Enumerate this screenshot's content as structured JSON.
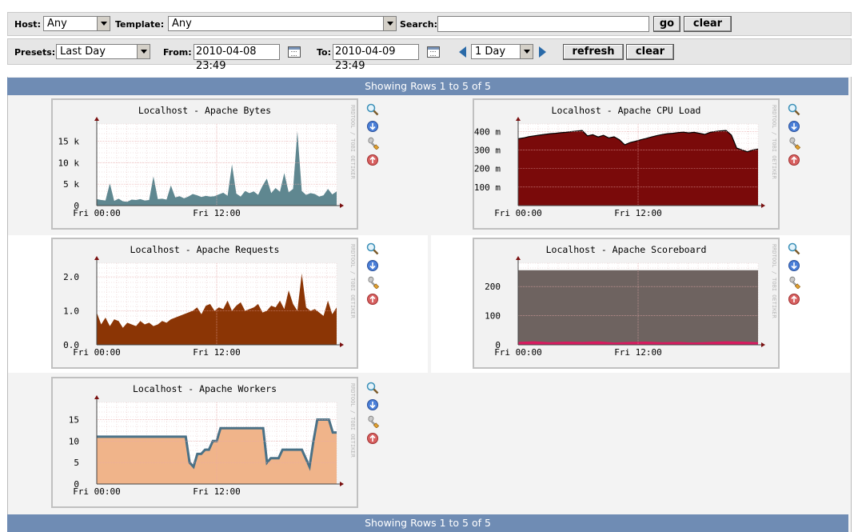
{
  "filter": {
    "host_label": "Host:",
    "host_value": "Any",
    "template_label": "Template:",
    "template_value": "Any",
    "search_label": "Search:",
    "search_value": "",
    "go_label": "go",
    "clear_label": "clear"
  },
  "timespan": {
    "presets_label": "Presets:",
    "presets_value": "Last Day",
    "from_label": "From:",
    "from_value": "2010-04-08 23:49",
    "to_label": "To:",
    "to_value": "2010-04-09 23:49",
    "shift_value": "1 Day",
    "refresh_label": "refresh",
    "clear_label": "clear"
  },
  "header_text": "Showing Rows 1 to 5 of 5",
  "footer_text": "Showing Rows 1 to 5 of 5",
  "watermark": "RRDTOOL / TOBI OETIKER",
  "colors": {
    "bytes": "#5f8790",
    "cpu": "#7a0a0a",
    "requests": "#8b3505",
    "scoreboard_fill": "#6e6360",
    "scoreboard_line": "#d81b60",
    "workers_area": "#f0b48a",
    "workers_line": "#4a7186",
    "bar_blue": "#6f8cb4"
  },
  "icons": [
    "zoom-icon",
    "download-icon",
    "edit-properties-icon",
    "go-up-icon"
  ],
  "graphs": [
    {
      "title": "Localhost - Apache Bytes",
      "yticks": [
        "0",
        "5 k",
        "10 k",
        "15 k"
      ],
      "xticks": [
        "Fri 00:00",
        "Fri 12:00"
      ]
    },
    {
      "title": "Localhost - Apache CPU Load",
      "yticks": [
        "100 m",
        "200 m",
        "300 m",
        "400 m"
      ],
      "xticks": [
        "Fri 00:00",
        "Fri 12:00"
      ]
    },
    {
      "title": "Localhost - Apache Requests",
      "yticks": [
        "0.0",
        "1.0",
        "2.0"
      ],
      "xticks": [
        "Fri 00:00",
        "Fri 12:00"
      ]
    },
    {
      "title": "Localhost - Apache Scoreboard",
      "yticks": [
        "0",
        "100",
        "200"
      ],
      "xticks": [
        "Fri 00:00",
        "Fri 12:00"
      ]
    },
    {
      "title": "Localhost - Apache Workers",
      "yticks": [
        "0",
        "5",
        "10",
        "15"
      ],
      "xticks": [
        "Fri 00:00",
        "Fri 12:00"
      ]
    }
  ],
  "chart_data": [
    {
      "type": "area",
      "title": "Localhost - Apache Bytes",
      "ylim": [
        0,
        19000
      ],
      "x": [
        "Fri 00:00",
        "Fri 12:00"
      ],
      "values": [
        1500,
        1300,
        1200,
        5200,
        1100,
        1600,
        1000,
        900,
        1400,
        1300,
        1500,
        1200,
        1300,
        6800,
        1500,
        1600,
        1400,
        4700,
        1900,
        2200,
        1700,
        2100,
        2700,
        2400,
        2000,
        2300,
        2100,
        2200,
        2600,
        3000,
        2300,
        9600,
        2800,
        2100,
        3400,
        2900,
        3300,
        2500,
        4600,
        6300,
        2900,
        4100,
        3200,
        7600,
        3100,
        3900,
        17300,
        3400,
        2500,
        2900,
        2700,
        2100,
        2400,
        3900,
        2600,
        3300
      ]
    },
    {
      "type": "area",
      "title": "Localhost - Apache CPU Load",
      "ylim": [
        0,
        440
      ],
      "x": [
        "Fri 00:00",
        "Fri 12:00"
      ],
      "values": [
        360,
        365,
        372,
        376,
        380,
        384,
        388,
        390,
        393,
        395,
        399,
        402,
        405,
        376,
        382,
        370,
        379,
        365,
        371,
        355,
        328,
        340,
        347,
        355,
        362,
        370,
        377,
        383,
        388,
        390,
        394,
        396,
        392,
        395,
        390,
        384,
        395,
        400,
        403,
        405,
        380,
        310,
        300,
        290,
        300,
        305
      ]
    },
    {
      "type": "area",
      "title": "Localhost - Apache Requests",
      "ylim": [
        0,
        2.4
      ],
      "x": [
        "Fri 00:00",
        "Fri 12:00"
      ],
      "values": [
        0.95,
        0.6,
        0.8,
        0.55,
        0.75,
        0.7,
        0.5,
        0.65,
        0.6,
        0.55,
        0.7,
        0.6,
        0.65,
        0.55,
        0.6,
        0.7,
        0.65,
        0.75,
        0.8,
        0.85,
        0.9,
        0.95,
        1.0,
        1.1,
        0.9,
        1.15,
        1.2,
        1.0,
        1.1,
        1.05,
        1.3,
        1.0,
        1.15,
        1.25,
        1.0,
        1.05,
        1.1,
        1.2,
        0.95,
        1.0,
        1.15,
        1.1,
        1.3,
        1.05,
        1.6,
        1.2,
        1.0,
        2.1,
        1.1,
        1.0,
        1.05,
        0.95,
        0.85,
        1.3,
        0.9,
        1.1
      ]
    },
    {
      "type": "area",
      "title": "Localhost - Apache Scoreboard",
      "ylim": [
        0,
        280
      ],
      "x": [
        "Fri 00:00",
        "Fri 12:00"
      ],
      "series": [
        {
          "values": [
            256,
            256,
            256,
            256,
            256,
            256,
            256,
            256,
            256,
            256,
            256,
            256,
            256,
            256,
            256,
            256
          ]
        },
        {
          "values": [
            10,
            12,
            9,
            11,
            10,
            12,
            8,
            10,
            11,
            9,
            10,
            8,
            10,
            12,
            11,
            9
          ]
        }
      ]
    },
    {
      "type": "area",
      "title": "Localhost - Apache Workers",
      "ylim": [
        0,
        19
      ],
      "x": [
        "Fri 00:00",
        "Fri 12:00"
      ],
      "values": [
        11,
        11,
        11,
        11,
        11,
        11,
        11,
        11,
        11,
        11,
        11,
        11,
        11,
        11,
        11,
        11,
        11,
        11,
        11,
        11,
        11,
        11,
        11,
        11,
        5,
        4,
        7,
        7,
        8,
        8,
        10,
        10,
        13,
        13,
        13,
        13,
        13,
        13,
        13,
        13,
        13,
        13,
        13,
        13,
        5,
        6,
        6,
        6,
        8,
        8,
        8,
        8,
        8,
        8,
        6,
        4,
        10,
        15,
        15,
        15,
        15,
        12,
        12
      ]
    }
  ]
}
